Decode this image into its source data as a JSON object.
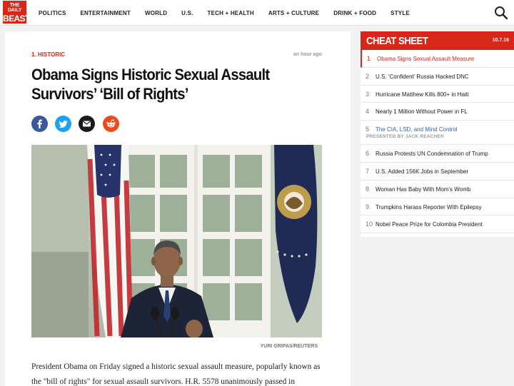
{
  "brand": {
    "line1": "THE DAILY",
    "line2": "BEAST",
    "color": "#d62718"
  },
  "nav": {
    "items": [
      "POLITICS",
      "ENTERTAINMENT",
      "WORLD",
      "U.S.",
      "TECH + HEALTH",
      "ARTS + CULTURE",
      "DRINK + FOOD",
      "STYLE"
    ],
    "search_icon": "search-icon"
  },
  "article": {
    "kicker": "1. HISTORIC",
    "timestamp": "an hour ago",
    "headline": "Obama Signs Historic Sexual Assault Survivors’ ‘Bill of Rights’",
    "share": [
      "facebook-icon",
      "twitter-icon",
      "email-icon",
      "reddit-icon"
    ],
    "photo_credit": "YURI GRIPAS/REUTERS",
    "body": "President Obama on Friday signed a historic sexual assault measure, popularly known as the \"bill of rights\" for sexual assault survivors. H.R. 5578 unanimously passed in"
  },
  "cheat_sheet": {
    "title": "CHEAT SHEET",
    "date": "10.7.16",
    "items": [
      {
        "num": "1",
        "text": "Obama Signs Sexual Assault Measure"
      },
      {
        "num": "2",
        "text": "U.S. ‘Confident’ Russia Hacked DNC"
      },
      {
        "num": "3",
        "text": "Hurricane Matthew Kills 800+ in Haiti"
      },
      {
        "num": "4",
        "text": "Nearly 1 Million Without Power in FL"
      },
      {
        "num": "5",
        "text": "The CIA, LSD, and Mind Control",
        "sub": "PRESENTED BY JACK REACHER"
      },
      {
        "num": "6",
        "text": "Russia Protests UN Condemnation of Trump"
      },
      {
        "num": "7",
        "text": "U.S. Added 156K Jobs in September"
      },
      {
        "num": "8",
        "text": "Woman Has Baby With Mom’s Womb"
      },
      {
        "num": "9",
        "text": "Trumpkins Harass Reporter With Epilepsy"
      },
      {
        "num": "10",
        "text": "Nobel Peace Prize for Colombia President"
      }
    ]
  }
}
